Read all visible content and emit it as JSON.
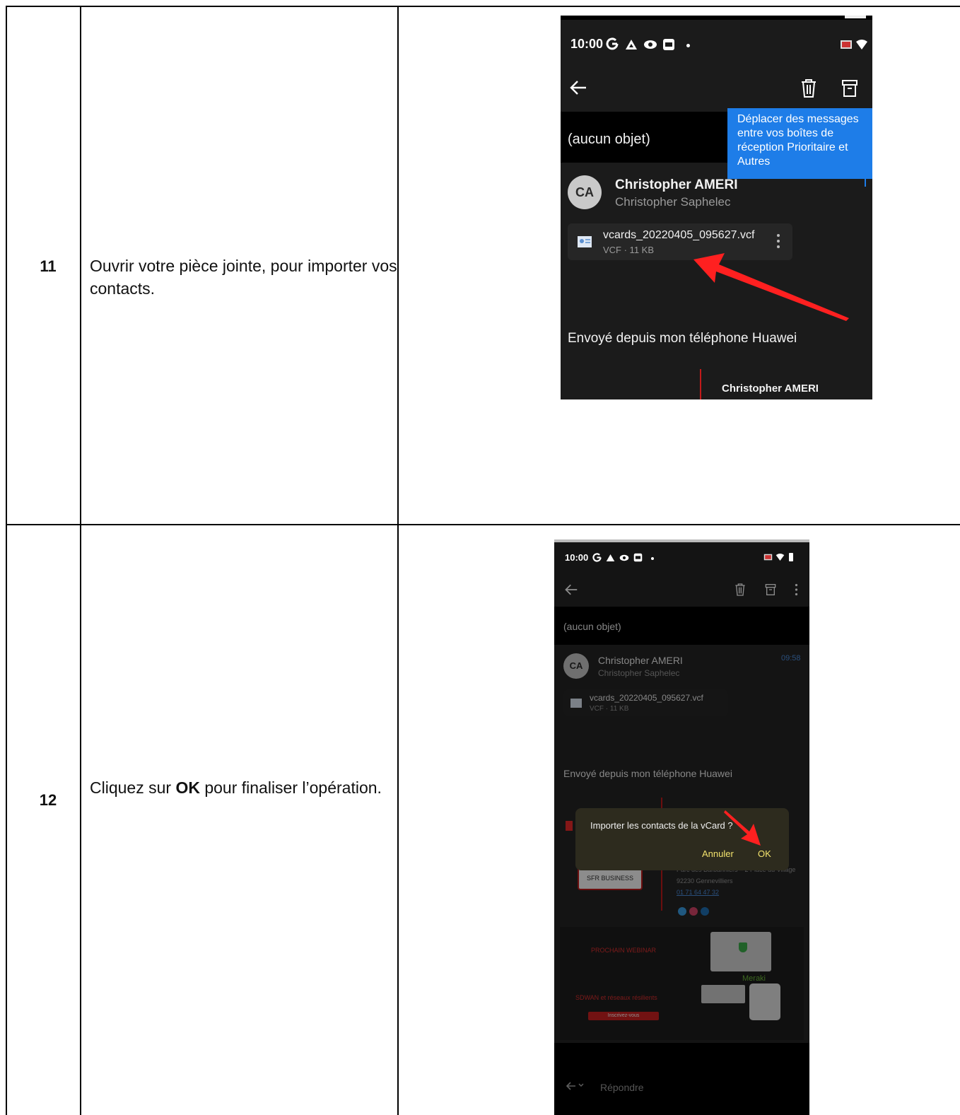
{
  "steps": [
    {
      "number": "11",
      "text": "Ouvrir votre pièce jointe, pour importer vos contacts.",
      "screenshot": {
        "time": "10:00",
        "subject": "(aucun objet)",
        "tooltip": "Déplacer des messages entre vos boîtes de réception Prioritaire et Autres",
        "avatar": "CA",
        "sender_name": "Christopher AMERI",
        "sender_sub": "Christopher Saphelec",
        "attachment_name": "vcards_20220405_095627.vcf",
        "attachment_meta": "VCF · 11 KB",
        "body": "Envoyé depuis mon téléphone Huawei",
        "signature_name": "Christopher AMERI",
        "arrow_color": "#ff2020",
        "tooltip_color": "#1e7de8"
      }
    },
    {
      "number": "12",
      "text_before": "Cliquez sur ",
      "text_bold": "OK",
      "text_after": " pour finaliser l’opération.",
      "screenshot": {
        "time": "10:00",
        "subject": "(aucun objet)",
        "avatar": "CA",
        "sender_name": "Christopher AMERI",
        "sender_sub": "Christopher Saphelec",
        "received_time": "09:58",
        "attachment_name": "vcards_20220405_095627.vcf",
        "attachment_meta": "VCF · 11 KB",
        "body": "Envoyé depuis mon téléphone Huawei",
        "dialog_text": "Importer les contacts de la vCard ?",
        "dialog_cancel": "Annuler",
        "dialog_ok": "OK",
        "address_line1": "Parc des Barbanniers – 2 Place du Village",
        "address_line2": "92230 Gennevilliers",
        "phone_link": "01 71 64 47 32",
        "sfr_logo": "SFR BUSINESS",
        "webinar_title": "PROCHAIN WEBINAR",
        "webinar_subtitle": "SDWAN et réseaux résilients",
        "webinar_button": "Inscrivez-vous",
        "meraki_label": "Meraki",
        "reply_label": "Répondre",
        "dialog_button_color": "#f3e36d",
        "arrow_color": "#ff2020"
      }
    }
  ]
}
